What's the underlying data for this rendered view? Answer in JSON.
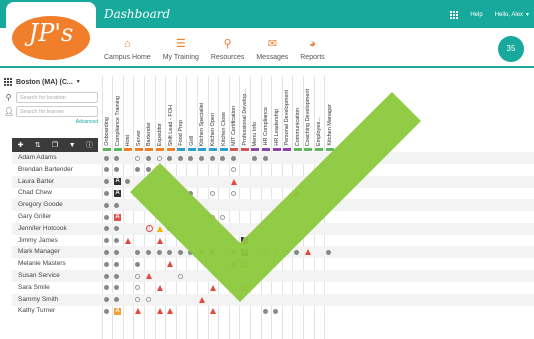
{
  "brand": {
    "logo_text": "JP's"
  },
  "header": {
    "title": "Dashboard",
    "help_label": "Help",
    "user_label": "Hello, Alex",
    "badge_count": "35"
  },
  "nav": [
    {
      "label": "Campus Home",
      "icon": "home-icon"
    },
    {
      "label": "My Training",
      "icon": "list-icon"
    },
    {
      "label": "Resources",
      "icon": "paperclip-icon"
    },
    {
      "label": "Messages",
      "icon": "envelope-icon"
    },
    {
      "label": "Reports",
      "icon": "pie-chart-icon"
    }
  ],
  "filters": {
    "location": "Boston (MA) (C...",
    "location_placeholder": "Search for location",
    "learner_placeholder": "Search for learner",
    "advanced_label": "Advanced"
  },
  "columns": [
    {
      "label": "Onboarding",
      "color": "#5cb85c"
    },
    {
      "label": "Compliance Training",
      "color": "#5cb85c"
    },
    {
      "label": "Host",
      "color": "#f07e2b"
    },
    {
      "label": "Server",
      "color": "#f07e2b"
    },
    {
      "label": "Bartender",
      "color": "#f07e2b"
    },
    {
      "label": "Expeditor",
      "color": "#f07e2b"
    },
    {
      "label": "Shift Lead - FOH",
      "color": "#f07e2b"
    },
    {
      "label": "Food Prep",
      "color": "#2a9fd6"
    },
    {
      "label": "Grill",
      "color": "#2a9fd6"
    },
    {
      "label": "Kitchen Specialist",
      "color": "#2a9fd6"
    },
    {
      "label": "Kitchen Open",
      "color": "#2a9fd6"
    },
    {
      "label": "Kitchen Close",
      "color": "#2a9fd6"
    },
    {
      "label": "MIT Certification",
      "color": "#d9534f"
    },
    {
      "label": "Professional Develop...",
      "color": "#d9534f"
    },
    {
      "label": "Menu Info",
      "color": "#8e44ad"
    },
    {
      "label": "HR Compliance",
      "color": "#8e44ad"
    },
    {
      "label": "HR Leadership",
      "color": "#8e44ad"
    },
    {
      "label": "Personal Development",
      "color": "#8e44ad"
    },
    {
      "label": "Communication",
      "color": "#5cb85c"
    },
    {
      "label": "Coaching Development",
      "color": "#5cb85c"
    },
    {
      "label": "Employee...",
      "color": "#5cb85c"
    },
    {
      "label": "Kitchen Manager",
      "color": "#5cb85c"
    }
  ],
  "learners": [
    {
      "name": "Adam Adams",
      "cells": [
        "g",
        "g",
        "",
        "o",
        "g",
        "o",
        "g",
        "g",
        "g",
        "g",
        "g",
        "g",
        "g",
        "",
        "g",
        "g",
        "",
        "",
        "",
        "",
        "",
        ""
      ]
    },
    {
      "name": "Brendan Bartender",
      "cells": [
        "g",
        "g",
        "",
        "g",
        "g",
        "",
        "",
        "",
        "",
        "",
        "",
        "",
        "o",
        "",
        "",
        "",
        "",
        "",
        "",
        "",
        "",
        ""
      ]
    },
    {
      "name": "Laura Barter",
      "cells": [
        "g",
        "sq-dk:A",
        "g",
        "",
        "",
        "",
        "",
        "",
        "",
        "",
        "",
        "",
        "tri",
        "",
        "",
        "",
        "",
        "",
        "",
        "",
        "",
        ""
      ]
    },
    {
      "name": "Chad Chew",
      "cells": [
        "g",
        "sq-dk:A",
        "",
        "",
        "",
        "",
        "",
        "",
        "g",
        "",
        "o",
        "",
        "o",
        "",
        "",
        "",
        "",
        "",
        "tri",
        "",
        "",
        ""
      ]
    },
    {
      "name": "Gregory Goode",
      "cells": [
        "g",
        "g",
        "",
        "",
        "",
        "",
        "",
        "",
        "",
        "",
        "",
        "",
        "",
        "",
        "",
        "",
        "",
        "",
        "",
        "",
        "",
        ""
      ]
    },
    {
      "name": "Gary Griller",
      "cells": [
        "g",
        "sq-rd:A",
        "",
        "",
        "",
        "",
        "",
        "",
        "",
        "",
        "o",
        "o",
        "",
        "",
        "",
        "",
        "",
        "",
        "",
        "",
        "",
        ""
      ]
    },
    {
      "name": "Jennifer Hotcook",
      "cells": [
        "g",
        "g",
        "",
        "",
        "ring:!",
        "tri-y",
        "g",
        "",
        "",
        "",
        "",
        "",
        "",
        "",
        "",
        "",
        "",
        "",
        "",
        "",
        "",
        ""
      ]
    },
    {
      "name": "Jimmy James",
      "cells": [
        "g",
        "g",
        "tri",
        "",
        "",
        "tri",
        "",
        "",
        "",
        "",
        "",
        "",
        "",
        "sq-dk:A",
        "",
        "",
        "",
        "",
        "",
        "",
        "",
        ""
      ]
    },
    {
      "name": "Mark Manager",
      "cells": [
        "g",
        "g",
        "",
        "g",
        "g",
        "g",
        "g",
        "g",
        "g",
        "g",
        "g",
        "",
        "g",
        "sq-dk:A",
        "",
        "o",
        "o",
        "o",
        "g",
        "tri",
        "",
        "g"
      ]
    },
    {
      "name": "Melanie Masters",
      "cells": [
        "g",
        "g",
        "",
        "g",
        "",
        "",
        "tri",
        "",
        "",
        "",
        "",
        "",
        "g",
        "sq-or:A",
        "",
        "",
        "",
        "",
        "",
        "",
        "",
        ""
      ]
    },
    {
      "name": "Susan Service",
      "cells": [
        "g",
        "g",
        "",
        "o",
        "tri",
        "",
        "",
        "o",
        "",
        "",
        "",
        "",
        "",
        "",
        "",
        "",
        "",
        "",
        "",
        "",
        "",
        ""
      ]
    },
    {
      "name": "Sara Smile",
      "cells": [
        "g",
        "g",
        "",
        "o",
        "",
        "tri",
        "",
        "",
        "",
        "",
        "tri",
        "",
        "",
        "sq-or:A",
        "",
        "",
        "",
        "",
        "",
        "",
        "",
        ""
      ]
    },
    {
      "name": "Sammy Smith",
      "cells": [
        "g",
        "g",
        "",
        "o",
        "o",
        "",
        "",
        "",
        "",
        "tri",
        "",
        "",
        "",
        "",
        "",
        "",
        "",
        "",
        "",
        "",
        "",
        ""
      ]
    },
    {
      "name": "Kathy Turner",
      "cells": [
        "g",
        "sq-or:A",
        "",
        "tri",
        "",
        "tri",
        "tri",
        "",
        "",
        "",
        "tri",
        "",
        "",
        "",
        "",
        "g",
        "g",
        "",
        "",
        "",
        "",
        ""
      ]
    }
  ],
  "overlay": {
    "icon": "checkmark-icon",
    "color": "#8cc83c"
  }
}
